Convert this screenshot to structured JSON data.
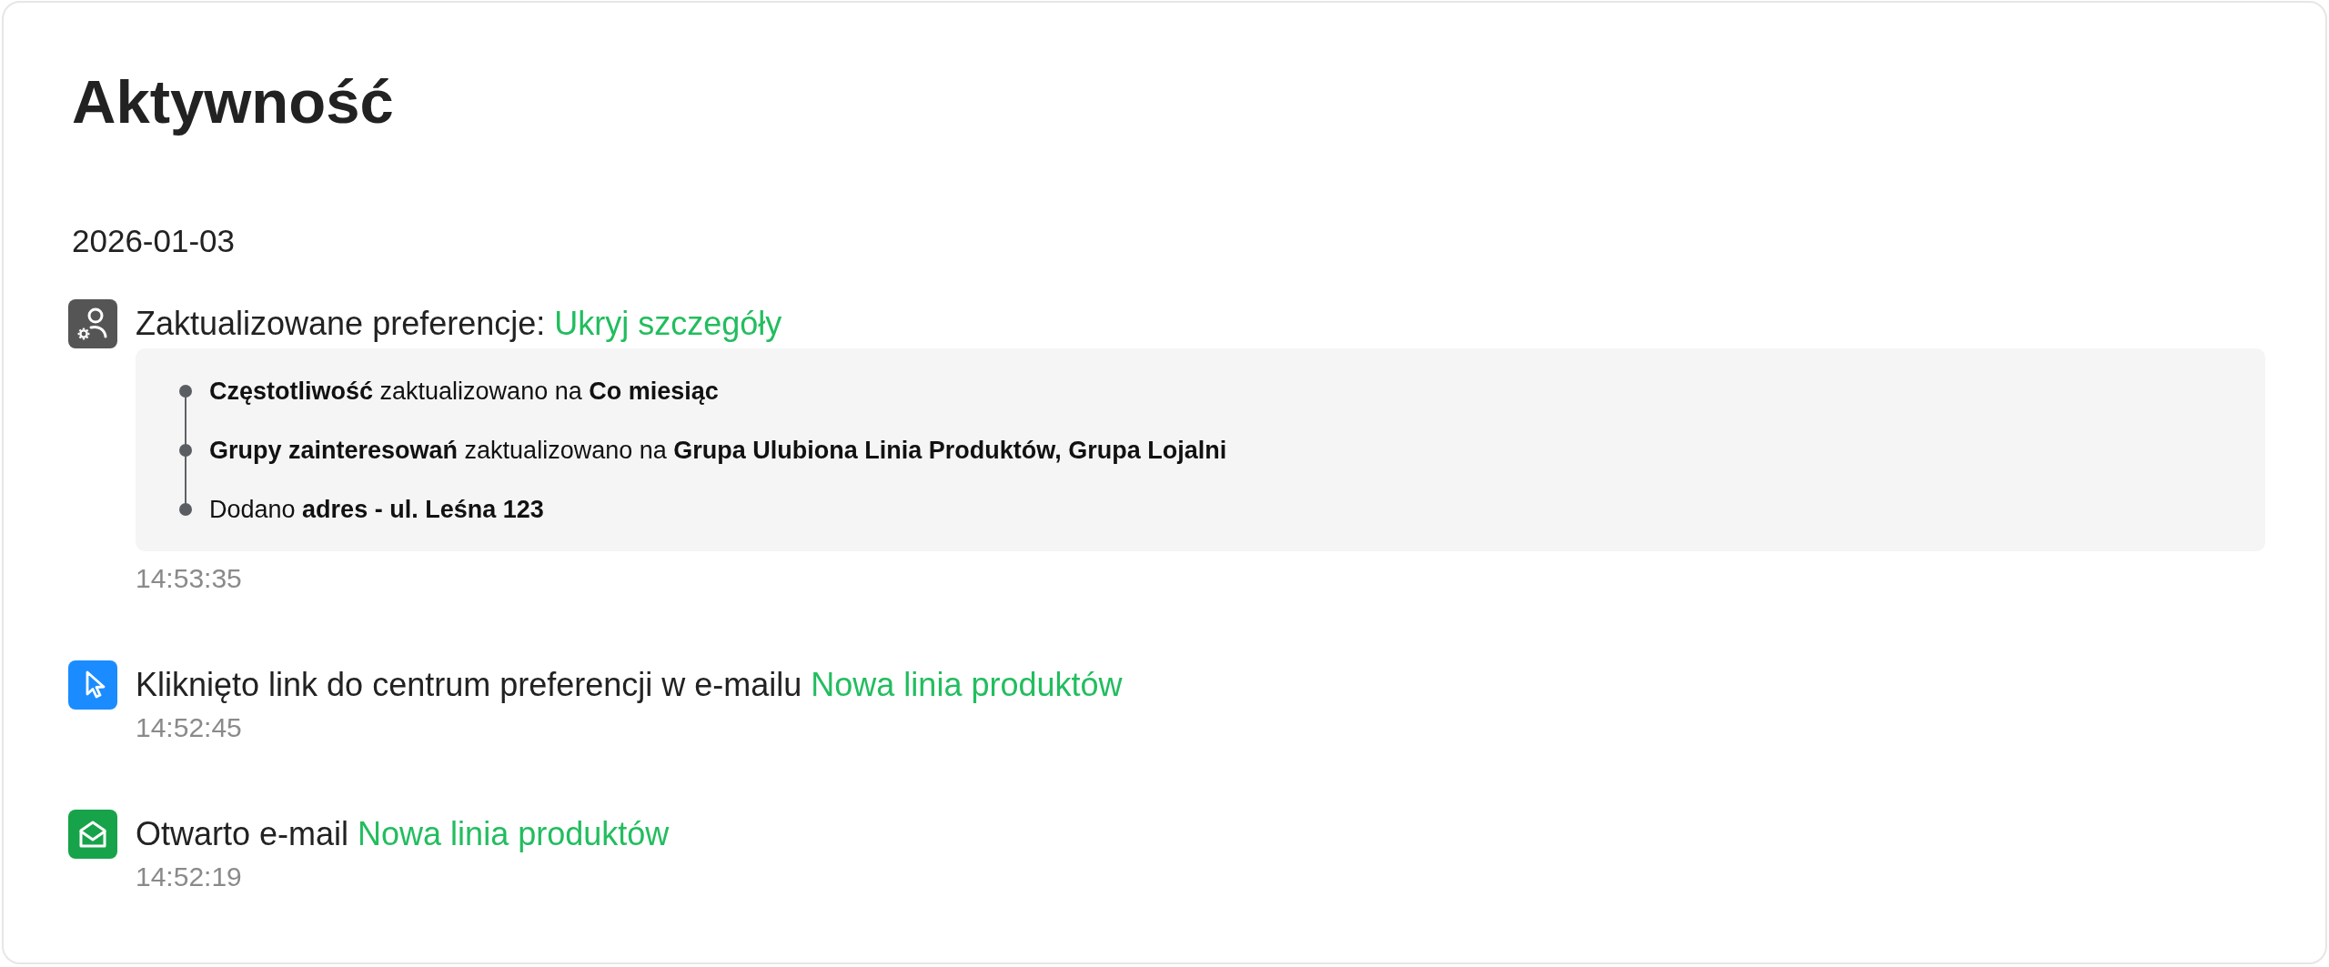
{
  "title": "Aktywność",
  "groups": [
    {
      "date": "2026-01-03",
      "events": [
        {
          "kind": "preferences",
          "text": "Zaktualizowane preferencje:",
          "link": "Ukryj szczegóły",
          "expanded": true,
          "details": [
            "**Częstotliwość** zaktualizowano na **Co miesiąc**",
            "**Grupy zainteresowań** zaktualizowano na **Grupa Ulubiona Linia Produktów, Grupa Lojalni**",
            "Dodano **adres - ul. Leśna 123**"
          ],
          "time": "14:53:35"
        },
        {
          "kind": "click",
          "text": "Kliknięto link do centrum preferencji w e-mailu",
          "link": "Nowa linia produktów",
          "time": "14:52:45"
        },
        {
          "kind": "open",
          "text": "Otwarto e-mail",
          "link": "Nowa linia produktów",
          "time": "14:52:19"
        }
      ]
    }
  ]
}
